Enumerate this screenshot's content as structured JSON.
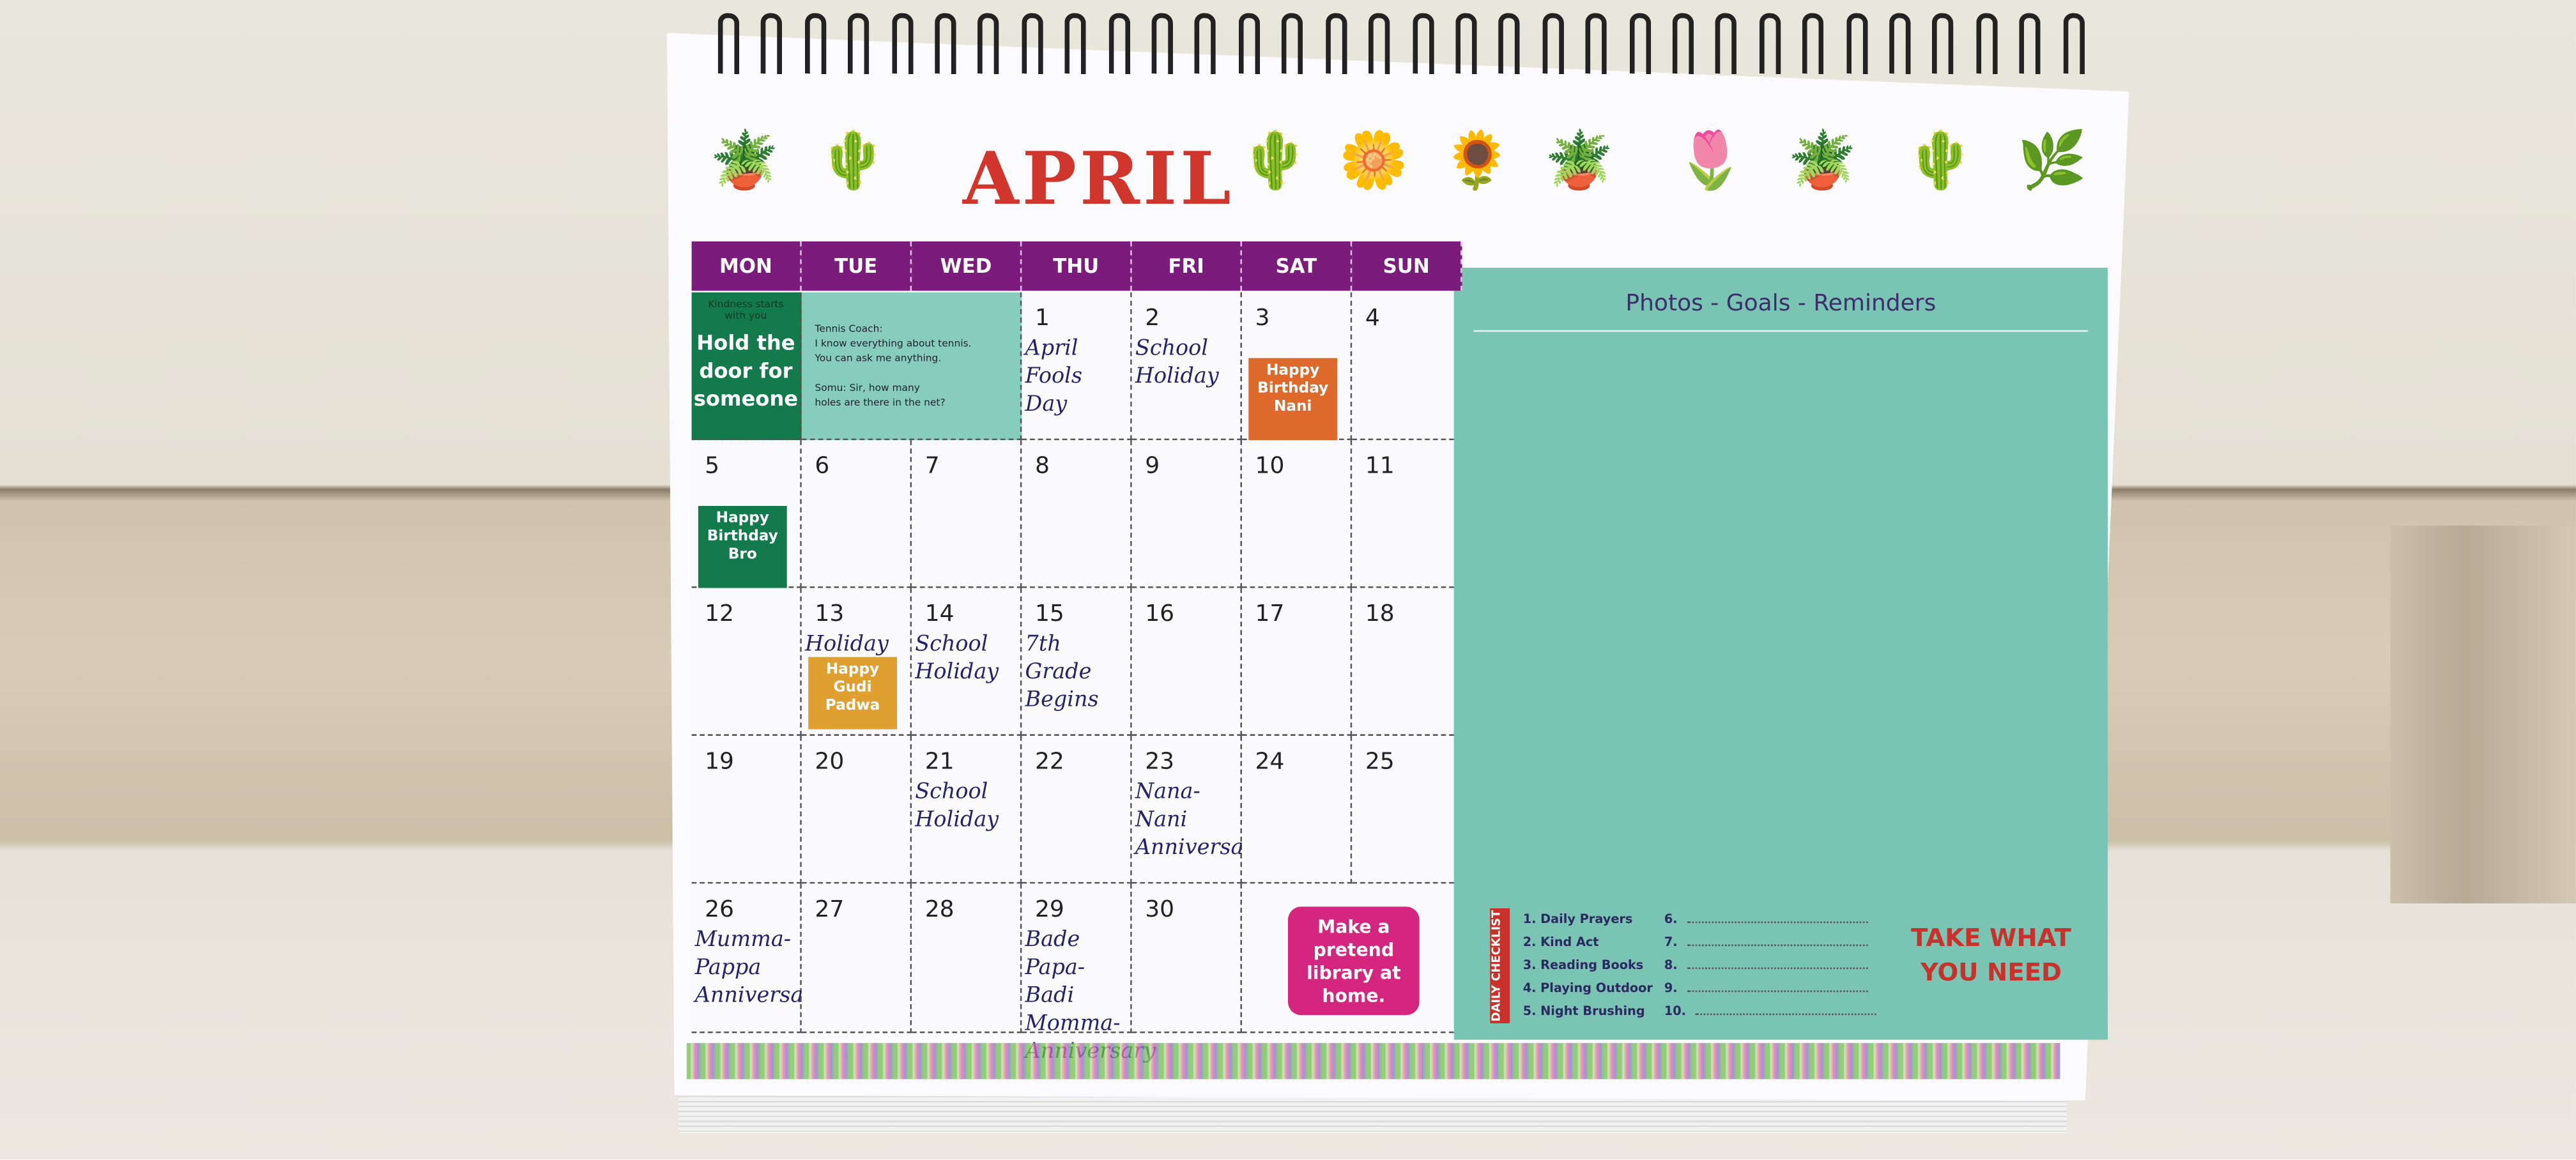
{
  "calendar": {
    "month": "APRIL",
    "days": [
      "MON",
      "TUE",
      "WED",
      "THU",
      "FRI",
      "SAT",
      "SUN"
    ],
    "mon_box": {
      "small": "Kindness starts with you",
      "big": "Hold the door for someone",
      "color": "#137a4c"
    },
    "joke_box": {
      "lines": [
        "Tennis Coach:",
        "I know everything about tennis.",
        "You can ask me anything.",
        "",
        "Somu: Sir, how many",
        "holes are there in the net?"
      ],
      "color": "#86cdbb"
    },
    "cells": [
      {
        "day": "1",
        "col": 3,
        "row": 0,
        "note": "April Fools Day"
      },
      {
        "day": "2",
        "col": 4,
        "row": 0,
        "note": "School Holiday"
      },
      {
        "day": "3",
        "col": 5,
        "row": 0,
        "sticker": "Happy Birthday Nani",
        "sticker_color": "#dd6a2a"
      },
      {
        "day": "4",
        "col": 6,
        "row": 0
      },
      {
        "day": "5",
        "col": 0,
        "row": 1,
        "sticker": "Happy Birthday Bro",
        "sticker_color": "#137a4c"
      },
      {
        "day": "6",
        "col": 1,
        "row": 1
      },
      {
        "day": "7",
        "col": 2,
        "row": 1
      },
      {
        "day": "8",
        "col": 3,
        "row": 1
      },
      {
        "day": "9",
        "col": 4,
        "row": 1
      },
      {
        "day": "10",
        "col": 5,
        "row": 1
      },
      {
        "day": "11",
        "col": 6,
        "row": 1
      },
      {
        "day": "12",
        "col": 0,
        "row": 2
      },
      {
        "day": "13",
        "col": 1,
        "row": 2,
        "note": "Holiday",
        "sticker": "Happy Gudi Padwa",
        "sticker_color": "#e0a030"
      },
      {
        "day": "14",
        "col": 2,
        "row": 2,
        "note": "School Holiday"
      },
      {
        "day": "15",
        "col": 3,
        "row": 2,
        "note": "7th Grade Begins"
      },
      {
        "day": "16",
        "col": 4,
        "row": 2
      },
      {
        "day": "17",
        "col": 5,
        "row": 2
      },
      {
        "day": "18",
        "col": 6,
        "row": 2
      },
      {
        "day": "19",
        "col": 0,
        "row": 3
      },
      {
        "day": "20",
        "col": 1,
        "row": 3
      },
      {
        "day": "21",
        "col": 2,
        "row": 3,
        "note": "School Holiday"
      },
      {
        "day": "22",
        "col": 3,
        "row": 3
      },
      {
        "day": "23",
        "col": 4,
        "row": 3,
        "note": "Nana-Nani Anniversary"
      },
      {
        "day": "24",
        "col": 5,
        "row": 3
      },
      {
        "day": "25",
        "col": 6,
        "row": 3
      },
      {
        "day": "26",
        "col": 0,
        "row": 4,
        "note": "Mumma-Pappa Anniversary"
      },
      {
        "day": "27",
        "col": 1,
        "row": 4
      },
      {
        "day": "28",
        "col": 2,
        "row": 4
      },
      {
        "day": "29",
        "col": 3,
        "row": 4,
        "note": "Bade Papa-Badi Momma-Anniversary"
      },
      {
        "day": "30",
        "col": 4,
        "row": 4
      }
    ],
    "pink_box": {
      "text": "Make a pretend library at home.",
      "color": "#d4267e"
    }
  },
  "panel": {
    "title": "Photos - Goals - Reminders",
    "checklist_label": "DAILY CHECKLIST",
    "items": [
      "1. Daily Prayers",
      "2. Kind Act",
      "3. Reading Books",
      "4. Playing Outdoor",
      "5. Night Brushing"
    ],
    "blank_items": [
      "6.",
      "7.",
      "8.",
      "9.",
      "10."
    ],
    "slogan": "TAKE WHAT YOU NEED"
  }
}
